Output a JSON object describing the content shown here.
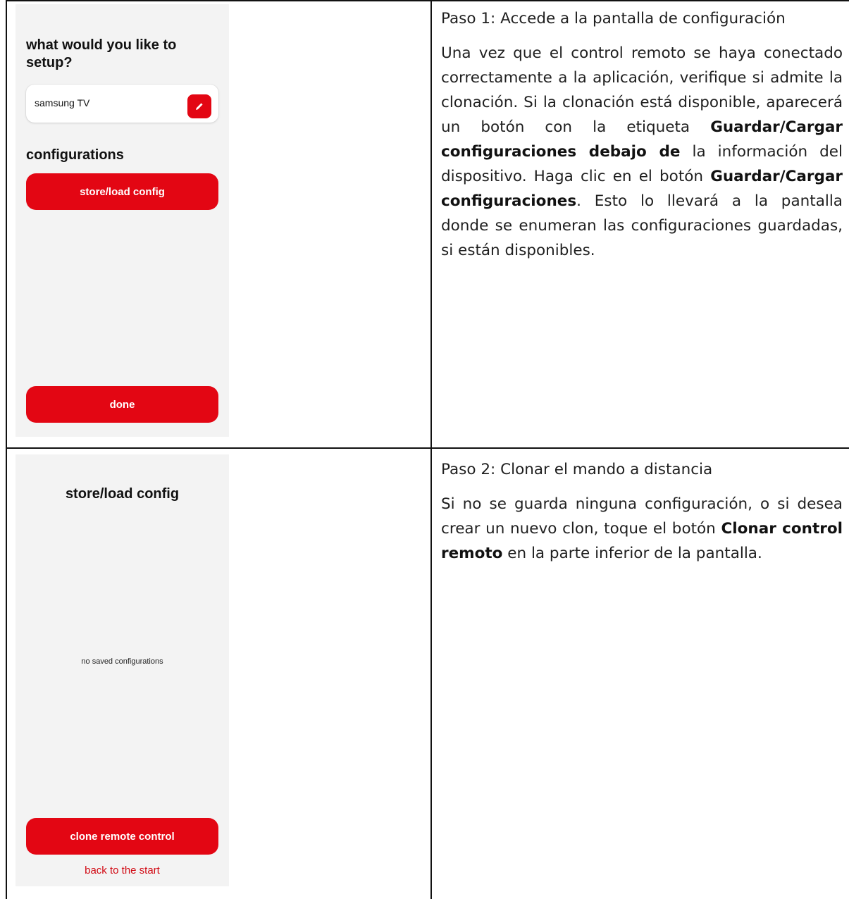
{
  "row1": {
    "phone": {
      "heading": "what would you like to setup?",
      "device_name": "samsung TV",
      "edit_icon": "pencil-icon",
      "section_title": "configurations",
      "store_button": "store/load config",
      "done_button": "done",
      "accent_color": "#e30613"
    },
    "text": {
      "title": "Paso 1: Accede a la pantalla de configuración",
      "p_part1": "Una vez que el control remoto se haya conectado correctamente a la aplicación, verifique si admite la clonación. Si la clonación está disponible, aparecerá un botón con la etiqueta ",
      "p_bold1": "Guardar/Cargar configuraciones debajo de",
      "p_part2": " la información del dispositivo. Haga clic en el botón ",
      "p_bold2": "Guardar/Cargar configuraciones",
      "p_part3": ". Esto lo llevará a la pantalla donde se enumeran las configuraciones guardadas, si están disponibles."
    }
  },
  "row2": {
    "phone": {
      "title": "store/load config",
      "empty_text": "no saved configurations",
      "clone_button": "clone remote control",
      "back_link": "back to the start"
    },
    "text": {
      "title": "Paso 2: Clonar el mando a distancia",
      "p_part1": "Si no se guarda ninguna configuración, o si desea crear un nuevo clon, toque el botón ",
      "p_bold1": "Clonar control remoto",
      "p_part2": " en la parte inferior de la pantalla."
    }
  }
}
